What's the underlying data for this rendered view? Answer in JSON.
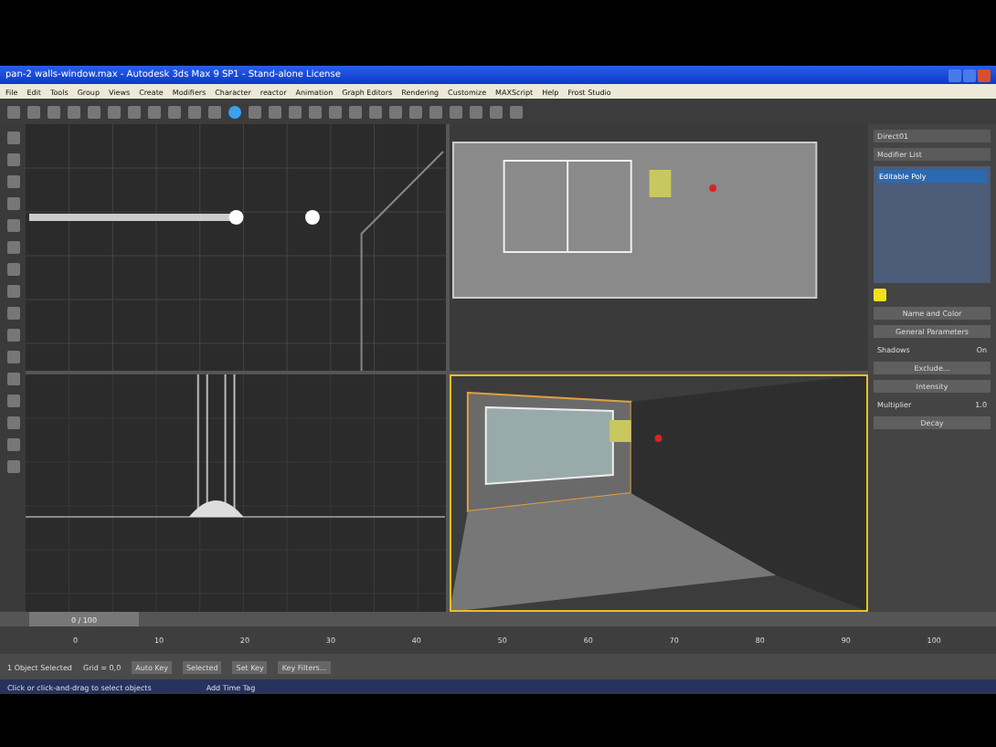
{
  "window": {
    "title": "pan-2 walls-window.max - Autodesk 3ds Max 9 SP1 - Stand-alone License"
  },
  "menu": [
    "File",
    "Edit",
    "Tools",
    "Group",
    "Views",
    "Create",
    "Modifiers",
    "Character",
    "reactor",
    "Animation",
    "Graph Editors",
    "Rendering",
    "Customize",
    "MAXScript",
    "Help",
    "Frost Studio"
  ],
  "command_panel": {
    "object_name": "Direct01",
    "modifier_list": "Modifier List",
    "stack": [
      {
        "label": "Editable Poly",
        "selected": true
      }
    ],
    "rollouts": [
      {
        "kind": "header",
        "label": "Name and Color"
      },
      {
        "kind": "header",
        "label": "General Parameters"
      },
      {
        "kind": "row",
        "label": "Shadows",
        "value": "On"
      },
      {
        "kind": "header",
        "label": "Exclude..."
      },
      {
        "kind": "header",
        "label": "Intensity"
      },
      {
        "kind": "row",
        "label": "Multiplier",
        "value": "1.0"
      },
      {
        "kind": "header",
        "label": "Decay"
      }
    ]
  },
  "timeline": {
    "position": "0 / 100",
    "level": 0,
    "ticks": [
      "0",
      "10",
      "20",
      "30",
      "40",
      "50",
      "60",
      "70",
      "80",
      "90",
      "100"
    ]
  },
  "status": {
    "selection": "1 Object Selected",
    "prompt": "Click or click-and-drag to select objects",
    "auto_key": "Auto Key",
    "selected": "Selected",
    "set_key": "Set Key",
    "key_filters": "Key Filters...",
    "time_tag": "Add Time Tag",
    "grid": "Grid = 0,0"
  }
}
